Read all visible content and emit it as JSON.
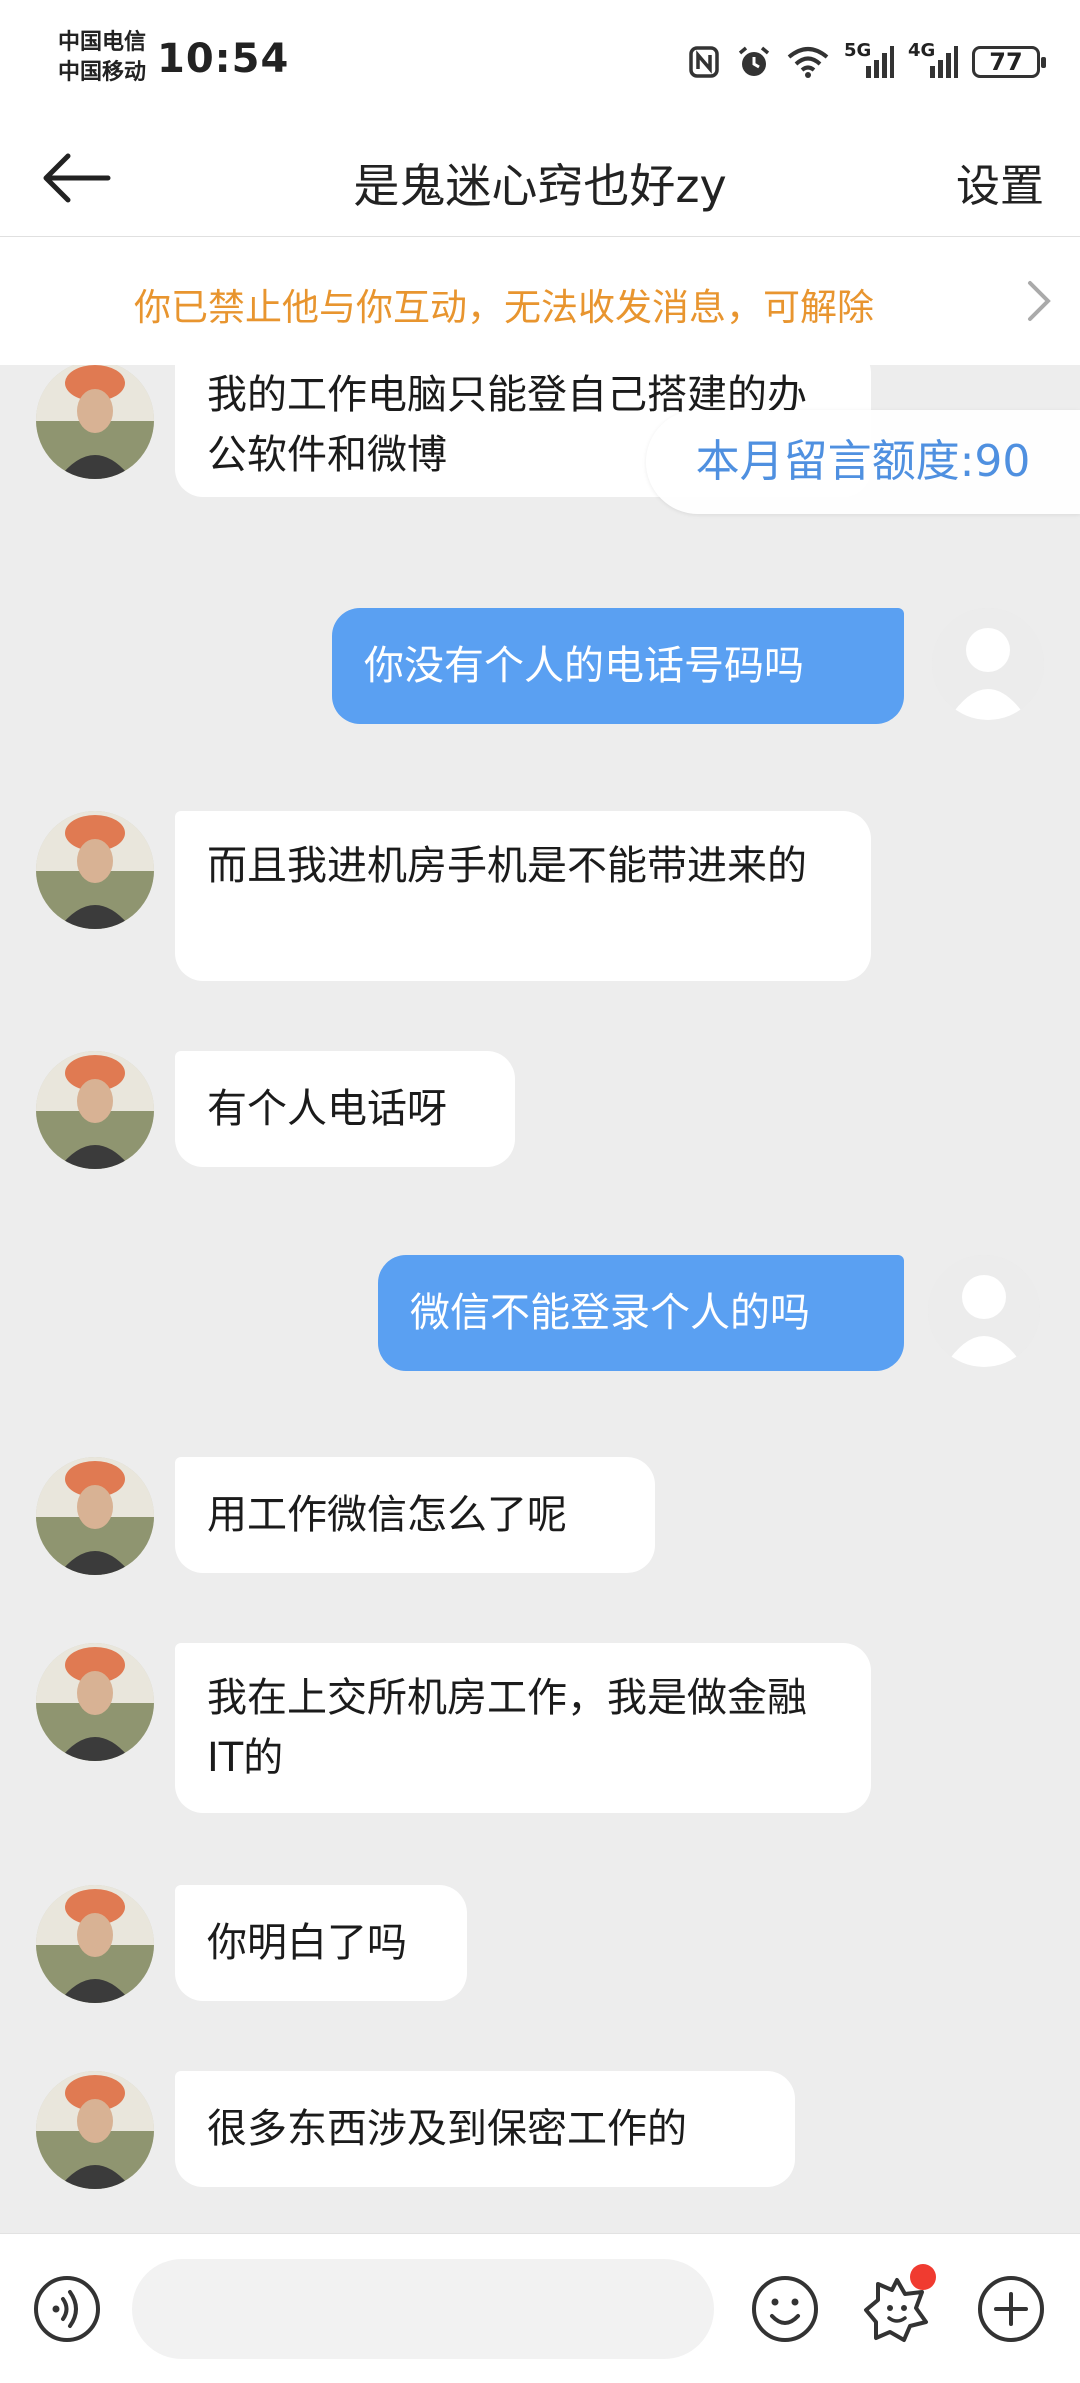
{
  "status_bar": {
    "carrier_1": "中国电信",
    "carrier_2": "中国移动",
    "time": "10:54",
    "network_1": "5G",
    "network_2": "4G",
    "battery": "77"
  },
  "nav": {
    "title": "是鬼迷心窍也好zy",
    "settings_label": "设置"
  },
  "banner": {
    "text": "你已禁止他与你互动，无法收发消息，可解除"
  },
  "quota": {
    "label": "本月留言额度:90"
  },
  "messages": [
    {
      "side": "left",
      "text": "我的工作电脑只能登自己搭建的办公软件和微博"
    },
    {
      "side": "right",
      "text": "你没有个人的电话号码吗"
    },
    {
      "side": "left",
      "text": "而且我进机房手机是不能带进来的"
    },
    {
      "side": "left",
      "text": "有个人电话呀"
    },
    {
      "side": "right",
      "text": "微信不能登录个人的吗"
    },
    {
      "side": "left",
      "text": "用工作微信怎么了呢"
    },
    {
      "side": "left",
      "text": "我在上交所机房工作，我是做金融IT的"
    },
    {
      "side": "left",
      "text": "你明白了吗"
    },
    {
      "side": "left",
      "text": "很多东西涉及到保密工作的"
    }
  ],
  "input": {
    "placeholder": ""
  },
  "colors": {
    "outgoing_bubble": "#5aa0f2",
    "banner_text": "#e8952f",
    "quota_text": "#4f90e0",
    "notification_dot": "#f03b30"
  },
  "icons": [
    "back-arrow-icon",
    "chevron-right-icon",
    "voice-icon",
    "emoji-icon",
    "sticker-icon",
    "plus-icon",
    "nfc-icon",
    "alarm-icon",
    "wifi-icon",
    "signal-icon"
  ]
}
